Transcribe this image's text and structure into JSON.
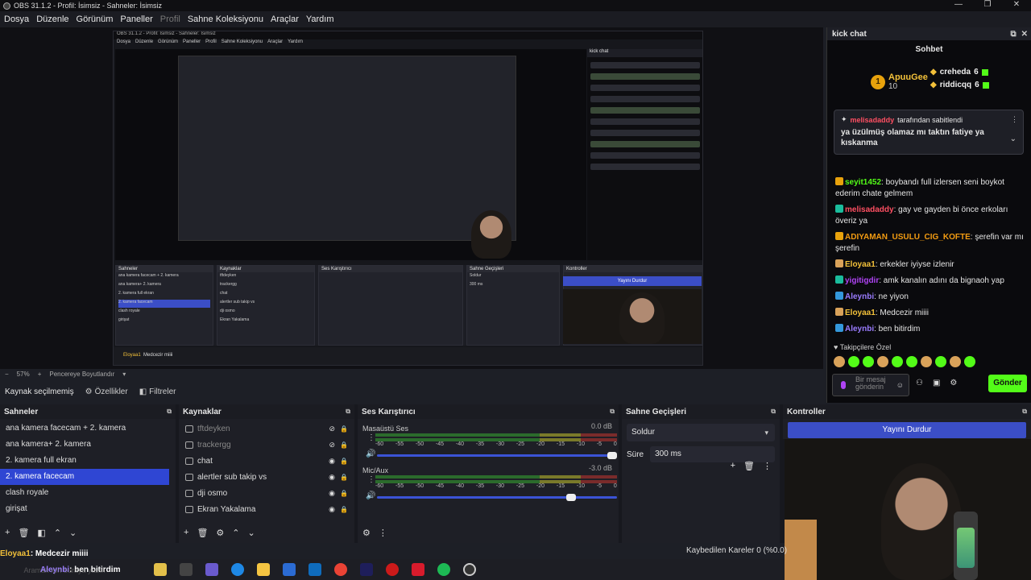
{
  "window": {
    "title": "OBS 31.1.2 - Profil: İsimsiz - Sahneler: İsimsiz",
    "controls": [
      "—",
      "❐",
      "✕"
    ]
  },
  "menu": [
    "Dosya",
    "Düzenle",
    "Görünüm",
    "Paneller",
    "Profil",
    "Sahne Koleksiyonu",
    "Araçlar",
    "Yardım"
  ],
  "nested": {
    "title": "OBS 31.1.2 - Profil: İsimsiz - Sahneler: İsimsiz",
    "menu": [
      "Dosya",
      "Düzenle",
      "Görünüm",
      "Paneller",
      "Profil",
      "Sahne Koleksiyonu",
      "Araçlar",
      "Yardım"
    ],
    "chat_title": "kick chat",
    "scenes_title": "Sahneler",
    "sources_title": "Kaynaklar",
    "mixer_title": "Ses Karıştırıcı",
    "transitions_title": "Sahne Geçişleri",
    "controls_title": "Kontroller",
    "stop_label": "Yayını Durdur",
    "scenes": [
      "ana kamera facecam + 2. kamera",
      "ana kamera+ 2. kamera",
      "2. kamera full ekran",
      "2. kamera facecam",
      "clash royale",
      "girişat"
    ],
    "sources": [
      "tftdeyken",
      "trackergg",
      "chat",
      "alertler sub takip vs",
      "dji osmo",
      "Ekran Yakalama"
    ],
    "transition": "Soldur",
    "duration": "300 ms",
    "frames": "Kaybedilen Kareler 0 (%0.0)",
    "no_source": "Kaynak seçilmemiş",
    "props": "Özellikler",
    "filters": "Filtreler",
    "zoom": "57%",
    "fit": "Pencereye Boyutlandır",
    "bottom_msg_user": "Eloyaa1",
    "bottom_msg": "Medcezir miiii"
  },
  "chat": {
    "panel_title": "kick chat",
    "title": "Sohbet",
    "leaders": [
      {
        "rank": "1",
        "name": "ApuuGee",
        "count": "10"
      },
      {
        "name": "creheda",
        "count": "6"
      },
      {
        "name": "riddicqq",
        "count": "6"
      }
    ],
    "pinned": {
      "user": "melisadaddy",
      "suffix": "tarafından sabitlendi",
      "message": "ya üzülmüş olamaz mı taktın fatiye ya kıskanma"
    },
    "messages": [
      {
        "user": "seyit1452",
        "text": ": boybandı full izlersen seni boykot ederim chate gelmem",
        "color": "#53fc18"
      },
      {
        "user": "melisadaddy",
        "text": ": gay ve gayden bi önce erkoları överiz ya",
        "color": "#ff4f62"
      },
      {
        "user": "ADIYAMAN_USULU_CIG_KOFTE",
        "text": ": şerefin var mı şerefin",
        "color": "#f39c12"
      },
      {
        "user": "Eloyaa1",
        "text": ": erkekler iyiyse izlenir",
        "color": "#f3c13a"
      },
      {
        "user": "yigitigdir",
        "text": ": amk kanalın adını da bignaoh yap",
        "color": "#b044f5"
      },
      {
        "user": "Aleynbi",
        "text": ": ne yiyon",
        "color": "#9a7cff"
      },
      {
        "user": "Eloyaa1",
        "text": ": Medcezir miiii",
        "color": "#f3c13a"
      },
      {
        "user": "Aleynbi",
        "text": ": ben bitirdim",
        "color": "#9a7cff"
      }
    ],
    "follow_label": "Takipçilere Özel",
    "input_placeholder": "Bir mesaj gönderin",
    "send": "Gönder"
  },
  "preview": {
    "zoom": "57%",
    "fit_label": "Pencereye Boyutlandır"
  },
  "status": {
    "no_source": "Kaynak seçilmemiş",
    "properties": "Özellikler",
    "filters": "Filtreler"
  },
  "scenes": {
    "title": "Sahneler",
    "items": [
      "ana kamera facecam + 2. kamera",
      "ana kamera+ 2. kamera",
      "2. kamera full ekran",
      "2. kamera  facecam",
      "clash royale",
      "girişat"
    ]
  },
  "sources": {
    "title": "Kaynaklar",
    "items": [
      "tftdeyken",
      "trackergg",
      "chat",
      "alertler sub takip vs",
      "dji osmo",
      "Ekran Yakalama"
    ]
  },
  "mixer": {
    "title": "Ses Karıştırıcı",
    "ticks": [
      "-60",
      "-55",
      "-50",
      "-45",
      "-40",
      "-35",
      "-30",
      "-25",
      "-20",
      "-15",
      "-10",
      "-5",
      "0"
    ],
    "channels": [
      {
        "name": "Masaüstü Ses",
        "db": "0.0 dB",
        "level": 1.0
      },
      {
        "name": "Mic/Aux",
        "db": "-3.0 dB",
        "level": 0.82
      }
    ]
  },
  "transitions": {
    "title": "Sahne Geçişleri",
    "value": "Soldur",
    "duration_label": "Süre",
    "duration": "300 ms"
  },
  "controls": {
    "title": "Kontroller",
    "stop": "Yayını Durdur"
  },
  "frames": "Kaybedilen Kareler 0 (%0.0)",
  "overlay": {
    "user1": "Eloyaa1",
    "msg1": ": Medcezir miiii",
    "user2": "Aleynbi",
    "msg2": ": ben bitirdim",
    "search": "Aramak için buraya yazın"
  }
}
